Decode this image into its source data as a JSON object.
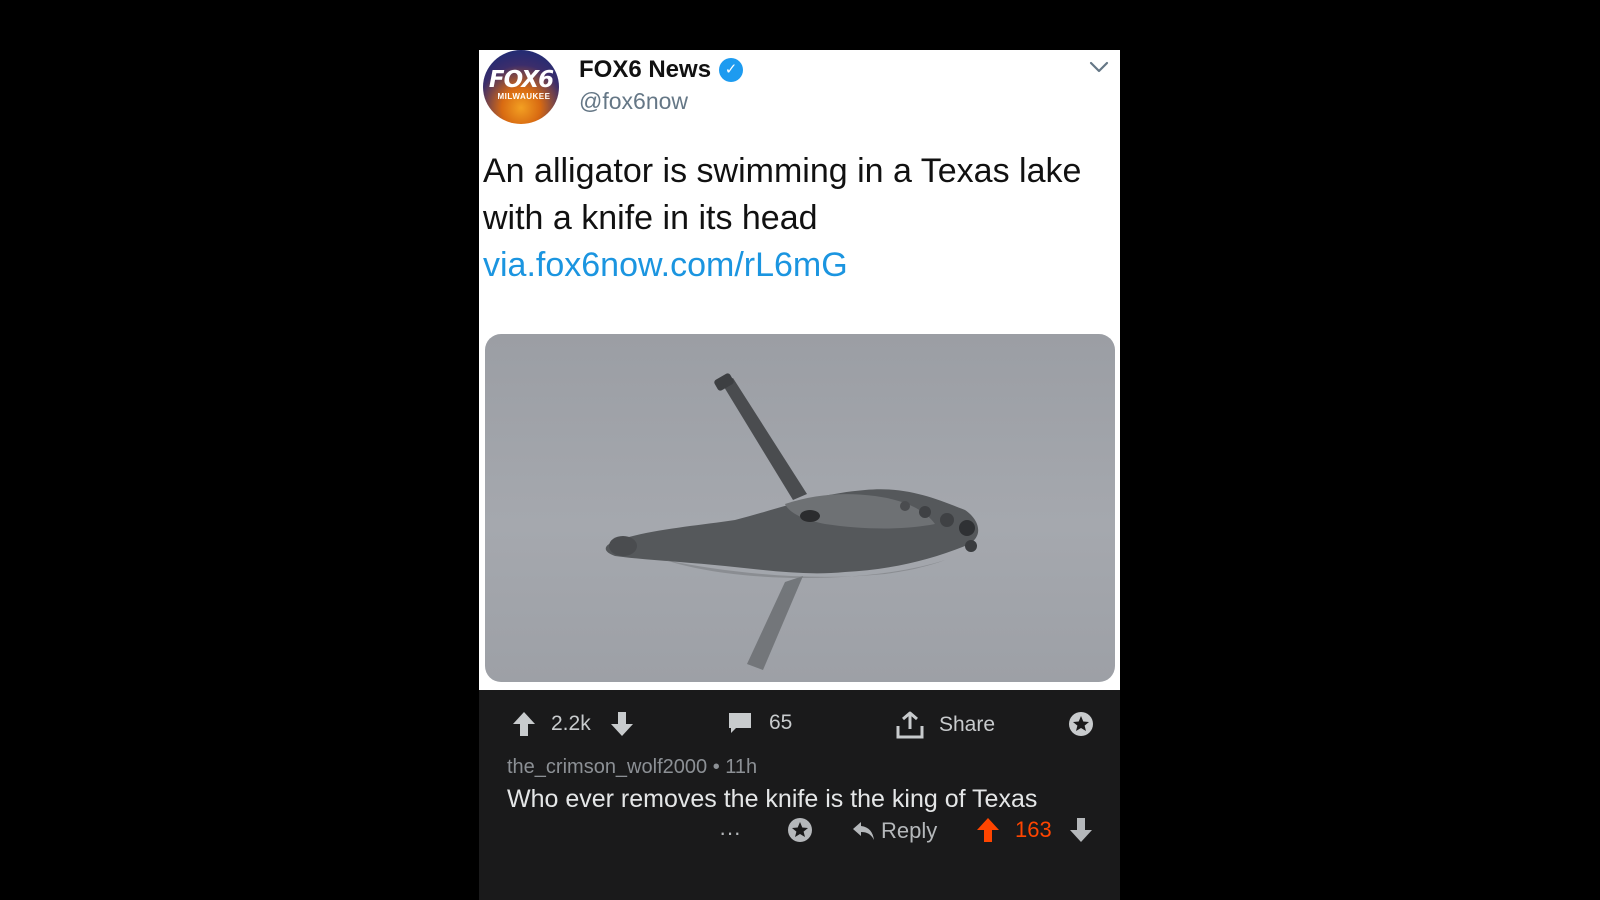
{
  "tweet": {
    "avatar_logo": "FOX6",
    "avatar_sub": "MILWAUKEE",
    "display_name": "FOX6 News",
    "handle": "@fox6now",
    "text": "An alligator is swimming in a Texas lake with a knife in its head",
    "link": "via.fox6now.com/rL6mG",
    "image_icon": "alligator-photo"
  },
  "post_actions": {
    "upvote_count": "2.2k",
    "comment_count": "65",
    "share_label": "Share"
  },
  "comment": {
    "author": "the_crimson_wolf2000",
    "separator": "•",
    "age": "11h",
    "text": "Who ever removes the knife is the king of Texas",
    "more_label": "···",
    "reply_label": "Reply",
    "score": "163"
  },
  "colors": {
    "verified": "#1d9bf0",
    "link": "#1b95e0",
    "upvoted": "#ff4500",
    "dark_bar": "#1a1a1b"
  }
}
